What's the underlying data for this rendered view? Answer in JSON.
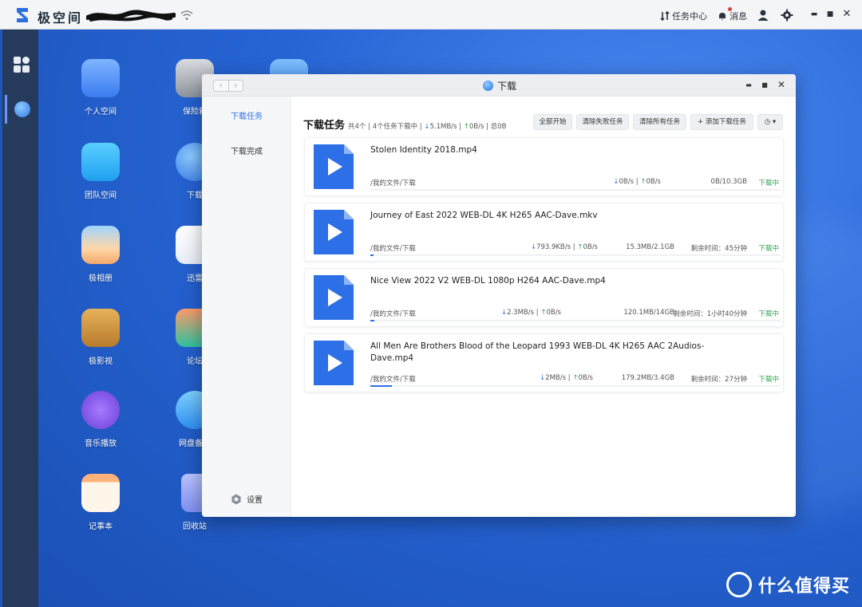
{
  "topbar": {
    "brand": "极空间",
    "task_center": "任务中心",
    "messages": "消息",
    "window_controls": {
      "minimize": "▬",
      "maximize": "■",
      "close": "✕"
    }
  },
  "desktop": {
    "col1": [
      "个人空间",
      "团队空间",
      "极相册",
      "极影视",
      "音乐播放",
      "记事本"
    ],
    "col2": [
      "保险箱",
      "下载",
      "迅雷",
      "论坛",
      "网盘备份",
      "回收站"
    ]
  },
  "window": {
    "title": "下载",
    "nav": {
      "back": "‹",
      "forward": "›"
    },
    "controls": {
      "minimize": "▬",
      "maximize": "■",
      "close": "✕"
    },
    "sidebar": {
      "items": [
        "下载任务",
        "下载完成"
      ],
      "settings": "设置"
    },
    "header": {
      "title": "下载任务",
      "stats_prefix": "共4个 | 4个任务下载中 |",
      "down_arrow": "↓",
      "down_speed": "5.1MB/s",
      "sep": "|",
      "up_arrow": "↑",
      "up_speed": "0B/s",
      "total": "| 总0B"
    },
    "toolbar": {
      "start_all": "全部开始",
      "clear_failed": "清除失败任务",
      "clear_all": "清除所有任务",
      "add_task": "+ 添加下载任务",
      "more": "◷ ▾"
    },
    "tasks": [
      {
        "name": "Stolen Identity 2018.mp4",
        "path": "/我的文件/下载",
        "down": "0B/s",
        "up": "0B/s",
        "size": "0B/10.3GB",
        "remaining": "",
        "status": "下载中",
        "progress": 0.0
      },
      {
        "name": "Journey of East 2022 WEB-DL 4K H265 AAC-Dave.mkv",
        "path": "/我的文件/下载",
        "down": "793.9KB/s",
        "up": "0B/s",
        "size": "15.3MB/2.1GB",
        "remaining": "剩余时间：45分钟",
        "status": "下载中",
        "progress": 0.007
      },
      {
        "name": "Nice View 2022 V2 WEB-DL 1080p H264 AAC-Dave.mp4",
        "path": "/我的文件/下载",
        "down": "2.3MB/s",
        "up": "0B/s",
        "size": "120.1MB/14GB",
        "remaining": "剩余时间：1小时40分钟",
        "status": "下载中",
        "progress": 0.009
      },
      {
        "name": "All Men Are Brothers Blood of the Leopard 1993 WEB-DL 4K H265 AAC 2Audios-Dave.mp4",
        "path": "/我的文件/下载",
        "down": "2MB/s",
        "up": "0B/s",
        "size": "179.2MB/3.4GB",
        "remaining": "剩余时间：27分钟",
        "status": "下载中",
        "progress": 0.052
      }
    ]
  },
  "watermark": "什么值得买",
  "colors": {
    "accent": "#2f6fe6",
    "upload": "#2da44e",
    "dock": "#263a5c",
    "desktop": "#2664d4"
  }
}
